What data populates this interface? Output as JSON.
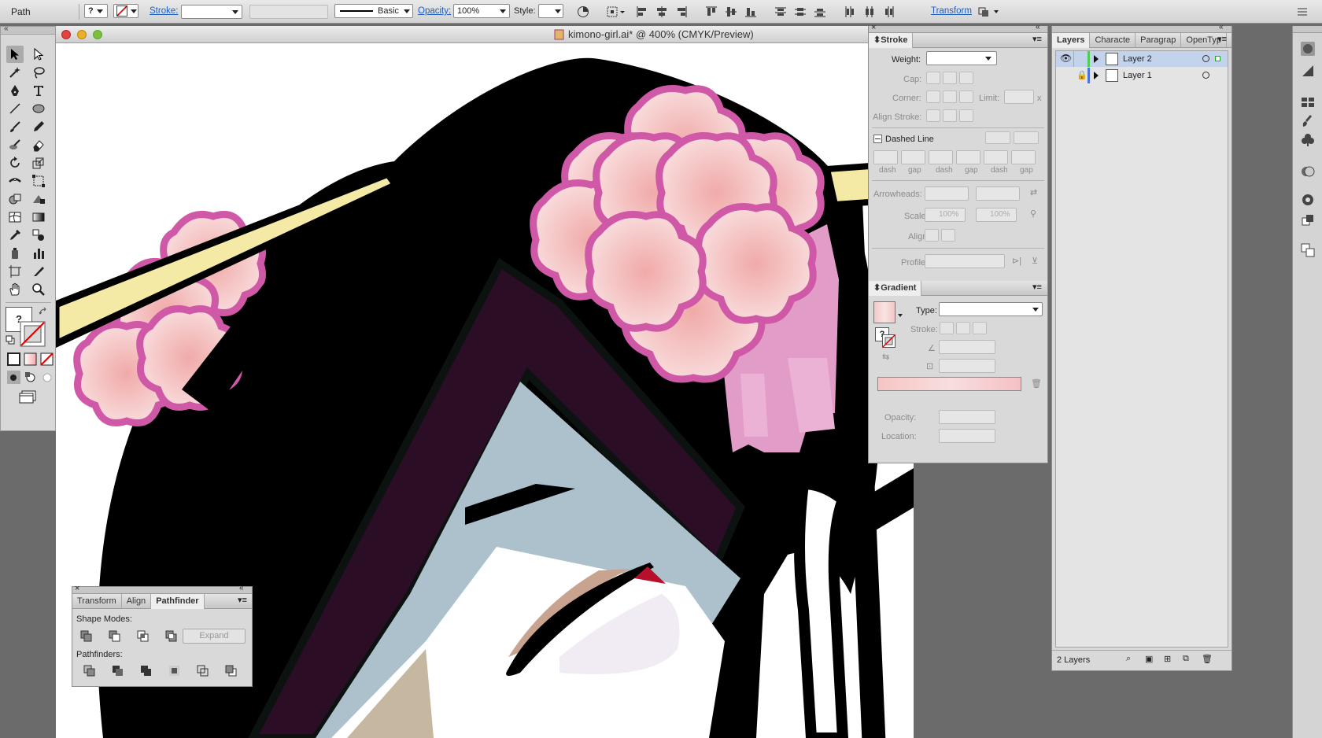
{
  "control_bar": {
    "selection_label": "Path",
    "fill_value": "?",
    "stroke_label": "Stroke:",
    "brush_label": "Basic",
    "opacity_label": "Opacity:",
    "opacity_value": "100%",
    "style_label": "Style:",
    "transform_label": "Transform"
  },
  "document": {
    "title": "kimono-girl.ai* @ 400% (CMYK/Preview)"
  },
  "stroke_panel": {
    "title": "Stroke",
    "weight_label": "Weight:",
    "cap_label": "Cap:",
    "corner_label": "Corner:",
    "limit_label": "Limit:",
    "limit_suffix": "x",
    "align_stroke_label": "Align Stroke:",
    "dashed_line_label": "Dashed Line",
    "dash_labels": [
      "dash",
      "gap",
      "dash",
      "gap",
      "dash",
      "gap"
    ],
    "arrowheads_label": "Arrowheads:",
    "scale_label": "Scale:",
    "scale_value_1": "100%",
    "scale_value_2": "100%",
    "align_label": "Align:",
    "profile_label": "Profile:"
  },
  "gradient_panel": {
    "title": "Gradient",
    "type_label": "Type:",
    "stroke_label": "Stroke:",
    "fill_value": "?",
    "opacity_label": "Opacity:",
    "location_label": "Location:"
  },
  "layers_panel": {
    "tabs": [
      "Layers",
      "Characte",
      "Paragrap",
      "OpenTyp"
    ],
    "layers": [
      {
        "name": "Layer 2",
        "selected": true,
        "visible": true,
        "locked": false
      },
      {
        "name": "Layer 1",
        "selected": false,
        "visible": false,
        "locked": true
      }
    ],
    "footer_count": "2 Layers"
  },
  "pathfinder_panel": {
    "tabs": [
      "Transform",
      "Align",
      "Pathfinder"
    ],
    "shape_modes_label": "Shape Modes:",
    "expand_label": "Expand",
    "pathfinders_label": "Pathfinders:"
  },
  "toolbar": {
    "fill_stroke_value": "?"
  },
  "colors": {
    "accent_link": "#1f5fbf",
    "layer_selected": "#c3d3ec",
    "flower_pink": "#d15aa8",
    "hair_black": "#000000"
  }
}
